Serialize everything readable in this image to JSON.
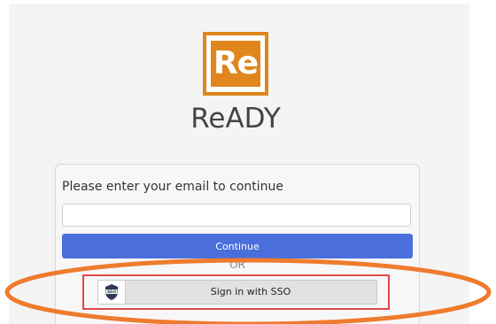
{
  "brand": {
    "logo_text": "Re",
    "app_name": "ReADY",
    "color": "#e0861c"
  },
  "login": {
    "prompt": "Please enter your email to continue",
    "email_value": "",
    "continue_label": "Continue",
    "divider_text": "OR",
    "sso_label": "Sign in with SSO",
    "sso_icon_text": "SSO",
    "continue_color": "#4a6fdc"
  },
  "annotation": {
    "ellipse_color": "#ee7b2e",
    "highlight_color": "#e04848"
  }
}
